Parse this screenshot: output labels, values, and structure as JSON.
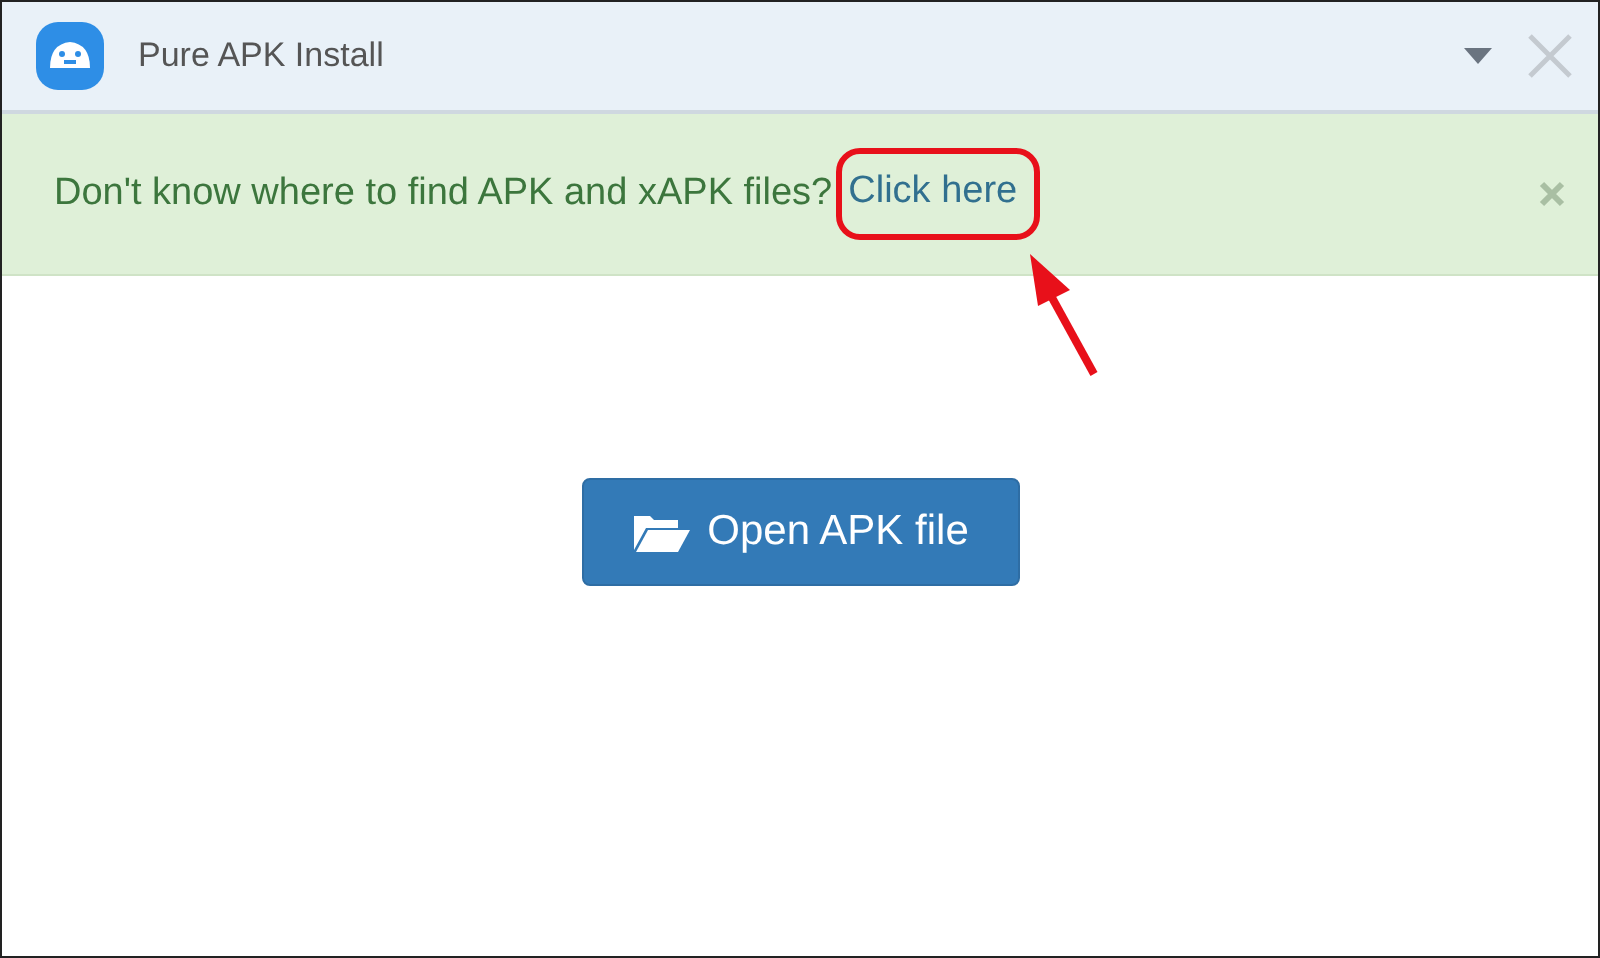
{
  "window": {
    "title": "Pure APK Install"
  },
  "banner": {
    "message": "Don't know where to find APK and xAPK files?",
    "link": "Click here"
  },
  "open_button": {
    "label": "Open APK file"
  }
}
